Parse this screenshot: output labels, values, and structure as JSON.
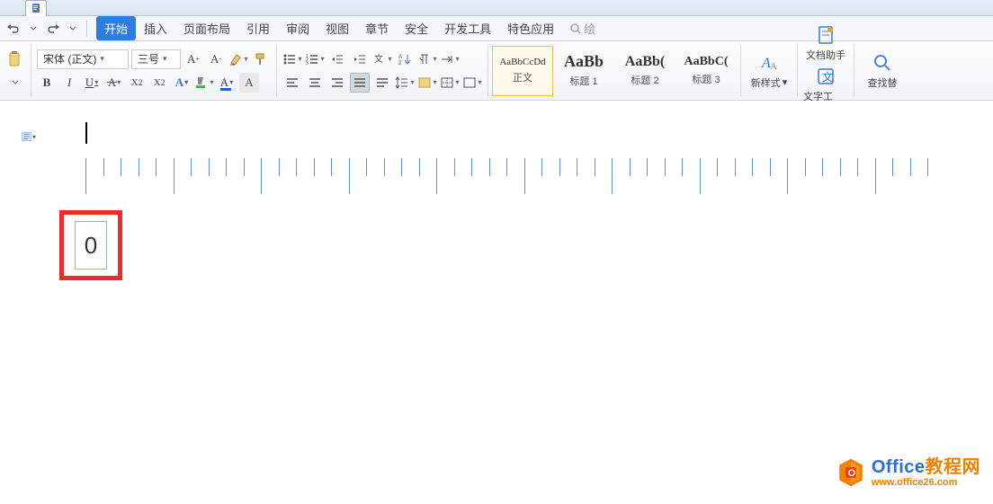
{
  "menu": {
    "start": "开始",
    "insert": "插入",
    "layout": "页面布局",
    "reference": "引用",
    "review": "审阅",
    "view": "视图",
    "chapter": "章节",
    "security": "安全",
    "devtools": "开发工具",
    "special": "特色应用"
  },
  "search_placeholder": "绘",
  "font": {
    "name": "宋体 (正文)",
    "size": "三号"
  },
  "styles": {
    "s1": {
      "preview": "AaBbCcDd",
      "label": "正文"
    },
    "s2": {
      "preview": "AaBb",
      "label": "标题 1"
    },
    "s3": {
      "preview": "AaBb(",
      "label": "标题 2"
    },
    "s4": {
      "preview": "AaBbC(",
      "label": "标题 3"
    }
  },
  "buttons": {
    "new_style": "新样式",
    "doc_helper": "文档助手",
    "text_tool": "文字工具",
    "find": "查找替"
  },
  "box_value": "0",
  "watermark": {
    "line1a": "Office",
    "line1b": "教程网",
    "line2": "www.office26.com"
  }
}
